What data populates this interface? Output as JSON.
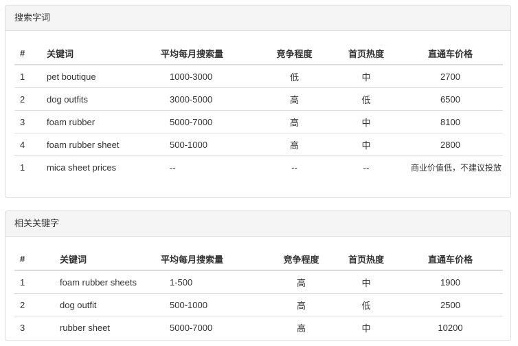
{
  "panel1": {
    "title": "搜索字词",
    "headers": [
      "#",
      "关键词",
      "平均每月搜索量",
      "竞争程度",
      "首页热度",
      "直通车价格"
    ],
    "rows": [
      [
        "1",
        "pet boutique",
        "1000-3000",
        "低",
        "中",
        "2700"
      ],
      [
        "2",
        "dog outfits",
        "3000-5000",
        "高",
        "低",
        "6500"
      ],
      [
        "3",
        "foam rubber",
        "5000-7000",
        "高",
        "中",
        "8100"
      ],
      [
        "4",
        "foam rubber sheet",
        "500-1000",
        "高",
        "中",
        "2800"
      ],
      [
        "1",
        "mica sheet prices",
        "--",
        "--",
        "--",
        "商业价值低，不建议投放"
      ]
    ]
  },
  "panel2": {
    "title": "相关关键字",
    "headers": [
      "#",
      "关键词",
      "平均每月搜索量",
      "竞争程度",
      "首页热度",
      "直通车价格"
    ],
    "rows": [
      [
        "1",
        "foam rubber sheets",
        "1-500",
        "高",
        "中",
        "1900"
      ],
      [
        "2",
        "dog outfit",
        "500-1000",
        "高",
        "低",
        "2500"
      ],
      [
        "3",
        "rubber sheet",
        "5000-7000",
        "高",
        "中",
        "10200"
      ]
    ]
  }
}
